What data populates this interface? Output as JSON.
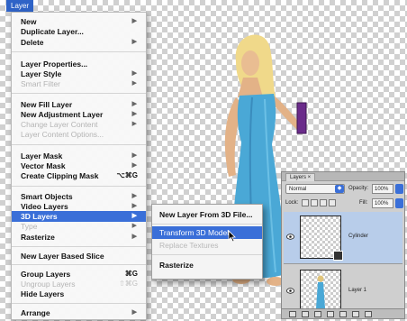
{
  "menu_bar": {
    "active_menu": "Layer"
  },
  "dropdown": {
    "items": [
      {
        "label": "New",
        "submenu": true,
        "disabled": false
      },
      {
        "label": "Duplicate Layer...",
        "submenu": false,
        "disabled": false
      },
      {
        "label": "Delete",
        "submenu": true,
        "disabled": false
      },
      {
        "label": "Layer Properties...",
        "submenu": false,
        "disabled": false
      },
      {
        "label": "Layer Style",
        "submenu": true,
        "disabled": false
      },
      {
        "label": "Smart Filter",
        "submenu": true,
        "disabled": true
      },
      {
        "label": "New Fill Layer",
        "submenu": true,
        "disabled": false
      },
      {
        "label": "New Adjustment Layer",
        "submenu": true,
        "disabled": false
      },
      {
        "label": "Change Layer Content",
        "submenu": true,
        "disabled": true
      },
      {
        "label": "Layer Content Options...",
        "submenu": false,
        "disabled": true
      },
      {
        "label": "Layer Mask",
        "submenu": true,
        "disabled": false
      },
      {
        "label": "Vector Mask",
        "submenu": true,
        "disabled": false
      },
      {
        "label": "Create Clipping Mask",
        "shortcut": "⌥⌘G",
        "disabled": false
      },
      {
        "label": "Smart Objects",
        "submenu": true,
        "disabled": false
      },
      {
        "label": "Video Layers",
        "submenu": true,
        "disabled": false
      },
      {
        "label": "3D Layers",
        "submenu": true,
        "disabled": false,
        "highlighted": true
      },
      {
        "label": "Type",
        "submenu": true,
        "disabled": true
      },
      {
        "label": "Rasterize",
        "submenu": true,
        "disabled": false
      },
      {
        "label": "New Layer Based Slice",
        "submenu": false,
        "disabled": false
      },
      {
        "label": "Group Layers",
        "shortcut": "⌘G",
        "disabled": false
      },
      {
        "label": "Ungroup Layers",
        "shortcut": "⇧⌘G",
        "disabled": true
      },
      {
        "label": "Hide Layers",
        "submenu": false,
        "disabled": false
      },
      {
        "label": "Arrange",
        "submenu": true,
        "disabled": false
      }
    ],
    "arrow_glyph": "▶"
  },
  "submenu": {
    "items": [
      {
        "label": "New Layer From 3D File...",
        "disabled": false
      },
      {
        "label": "Transform 3D Model",
        "disabled": false,
        "highlighted": true
      },
      {
        "label": "Replace Textures",
        "disabled": true
      },
      {
        "label": "Rasterize",
        "disabled": false
      }
    ]
  },
  "layers_panel": {
    "tab_label": "Layers ×",
    "blend_mode": "Normal",
    "opacity_label": "Opacity:",
    "opacity_value": "100%",
    "lock_label": "Lock:",
    "fill_label": "Fill:",
    "fill_value": "100%",
    "layers": [
      {
        "name": "Cylinder",
        "selected": true
      },
      {
        "name": "Layer 1",
        "selected": false
      }
    ]
  },
  "colors": {
    "accent": "#3a6fd8",
    "dress": "#4aa8d6",
    "book": "#6a2b8a"
  }
}
